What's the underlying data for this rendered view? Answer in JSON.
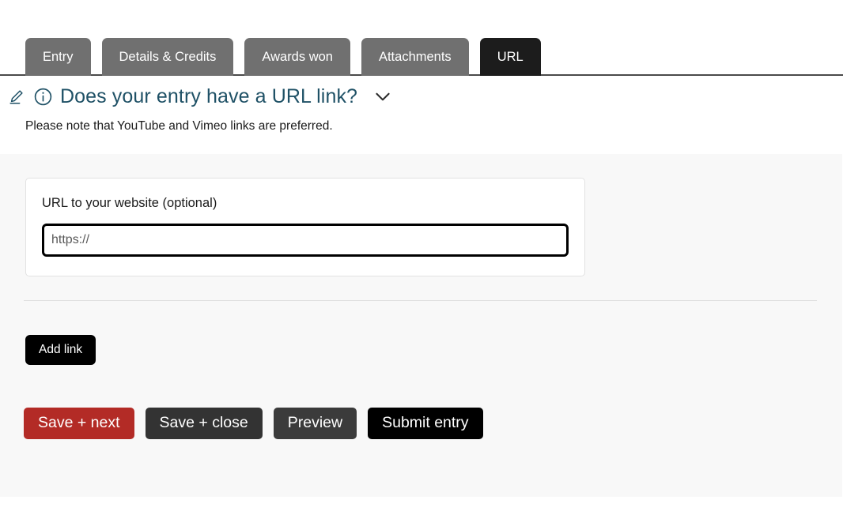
{
  "tabs": [
    {
      "label": "Entry",
      "active": false
    },
    {
      "label": "Details & Credits",
      "active": false
    },
    {
      "label": "Awards won",
      "active": false
    },
    {
      "label": "Attachments",
      "active": false
    },
    {
      "label": "URL",
      "active": true
    }
  ],
  "question": {
    "edit_icon": "pencil-icon",
    "info_icon": "info-circle-icon",
    "chevron_icon": "chevron-down-icon",
    "title": "Does your entry have a URL link?",
    "note": "Please note that YouTube and Vimeo links are preferred.",
    "title_color": "#1f5166"
  },
  "url_card": {
    "label": "URL to your website (optional)",
    "input_value": "",
    "input_placeholder": "https://",
    "focused": true
  },
  "add_link": {
    "label": "Add link"
  },
  "actions": [
    {
      "label": "Save + next",
      "color": "#b32b26"
    },
    {
      "label": "Save + close",
      "color": "#333333"
    },
    {
      "label": "Preview",
      "color": "#3b3b3b"
    },
    {
      "label": "Submit entry",
      "color": "#000000"
    }
  ]
}
